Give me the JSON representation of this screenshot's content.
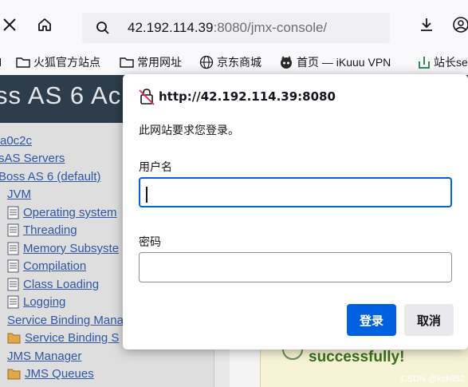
{
  "browser": {
    "url_host": "42.192.114.39",
    "url_rest": ":8080/jmx-console/",
    "bookmarks": [
      "火狐官方站点",
      "常用网址",
      "京东商城",
      "首页 — iKuuu VPN",
      "站长se"
    ]
  },
  "page": {
    "header_title": "ss AS 6 Ac",
    "tree": [
      "a0c2c",
      "sAS Servers",
      "Boss AS 6 (default)",
      "JVM",
      "Operating system",
      "Threading",
      "Memory Subsyste",
      "Compilation",
      "Class Loading",
      "Logging",
      "Service Binding Mana",
      "Service Binding S",
      "JMS Manager",
      "JMS Queues"
    ],
    "success_text": "successfully!",
    "watermark": "CSDN @ksk852"
  },
  "dialog": {
    "origin": "http://42.192.114.39:8080",
    "message": "此网站要求您登录。",
    "username_label": "用户名",
    "username_value": "",
    "password_label": "密码",
    "password_value": "",
    "login_label": "登录",
    "cancel_label": "取消"
  },
  "colors": {
    "accent": "#0061e0",
    "jboss_header": "#2d3d4b",
    "link": "#2f55a4"
  }
}
